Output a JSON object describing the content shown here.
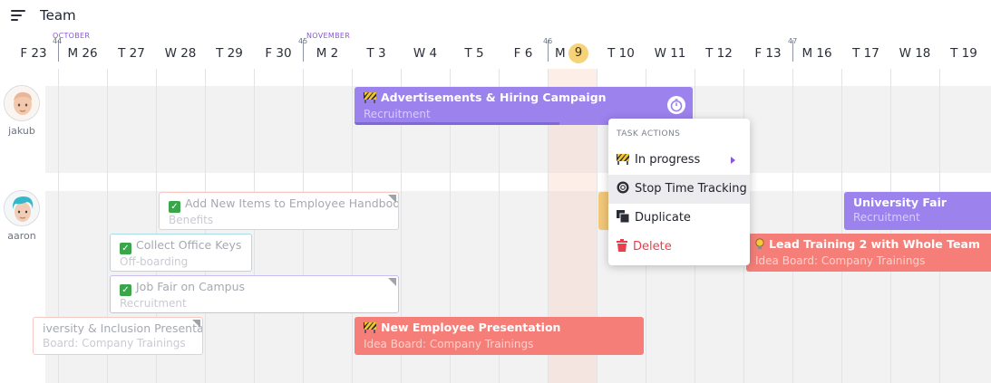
{
  "header": {
    "title": "Team"
  },
  "timeline": {
    "days": [
      "F 23",
      "M 26",
      "T 27",
      "W 28",
      "T 29",
      "F 30",
      "M 2",
      "T 3",
      "W 4",
      "T 5",
      "F 6",
      "M",
      "T 10",
      "W 11",
      "T 12",
      "F 13",
      "M 16",
      "T 17",
      "W 18",
      "T 19"
    ],
    "today": "9",
    "weeks": [
      "44",
      "45",
      "46",
      "47"
    ],
    "months": [
      "OCTOBER",
      "NOVEMBER"
    ]
  },
  "users": [
    {
      "name": "jakub"
    },
    {
      "name": "aaron"
    }
  ],
  "tasks": {
    "advertisements": {
      "title": "Advertisements & Hiring Campaign",
      "subtitle": "Recruitment",
      "icon": "barrier-icon"
    },
    "handbook": {
      "title": "Add New Items to Employee Handbook",
      "subtitle": "Benefits",
      "icon": "checkbox-icon"
    },
    "office_keys": {
      "title": "Collect Office Keys",
      "subtitle": "Off-boarding",
      "icon": "checkbox-icon"
    },
    "job_fair": {
      "title": "Job Fair on Campus",
      "subtitle": "Recruitment",
      "icon": "checkbox-icon"
    },
    "diversity": {
      "title": "iversity & Inclusion Presentat",
      "subtitle": "Board: Company Trainings"
    },
    "new_employee": {
      "title": "New Employee Presentation",
      "subtitle": "Idea Board: Company Trainings",
      "icon": "barrier-icon"
    },
    "university_fair": {
      "title": "University Fair",
      "subtitle": "Recruitment"
    },
    "lead_training": {
      "title": "Lead Training 2 with Whole Team",
      "subtitle": "Idea Board: Company Trainings",
      "icon": "lightbulb-icon"
    }
  },
  "context_menu": {
    "heading": "TASK ACTIONS",
    "items": [
      {
        "label": "In progress",
        "icon": "barrier-icon"
      },
      {
        "label": "Stop Time Tracking",
        "icon": "stop-circle-icon"
      },
      {
        "label": "Duplicate",
        "icon": "duplicate-icon"
      },
      {
        "label": "Delete",
        "icon": "trash-icon"
      }
    ]
  },
  "colors": {
    "purple_task": "#9b82ec",
    "red_task": "#f57f78",
    "today_highlight": "#f6d278",
    "month_label": "#8a58d6",
    "delete": "#ec3d4a"
  }
}
